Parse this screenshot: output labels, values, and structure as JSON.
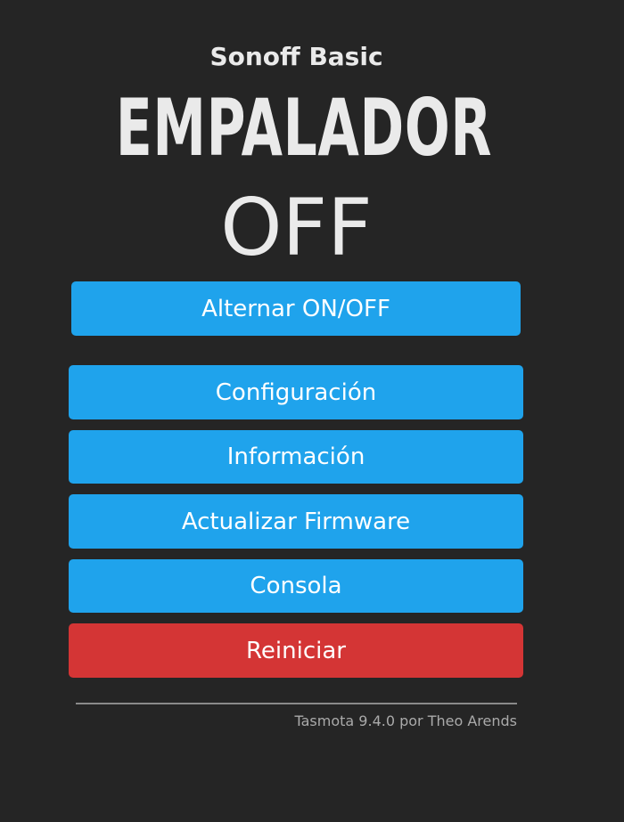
{
  "header": {
    "module": "Sonoff Basic",
    "device_name": "EMPALADOR",
    "power_state": "OFF"
  },
  "toggle_button": {
    "label": "Alternar ON/OFF"
  },
  "menu": {
    "configuration_label": "Configuración",
    "information_label": "Información",
    "firmware_label": "Actualizar Firmware",
    "console_label": "Consola",
    "restart_label": "Reiniciar"
  },
  "footer": {
    "text": "Tasmota 9.4.0 por Theo Arends"
  },
  "colors": {
    "background": "#252525",
    "primary_button": "#1fa3ec",
    "danger_button": "#d43535",
    "text": "#eaeaea"
  }
}
